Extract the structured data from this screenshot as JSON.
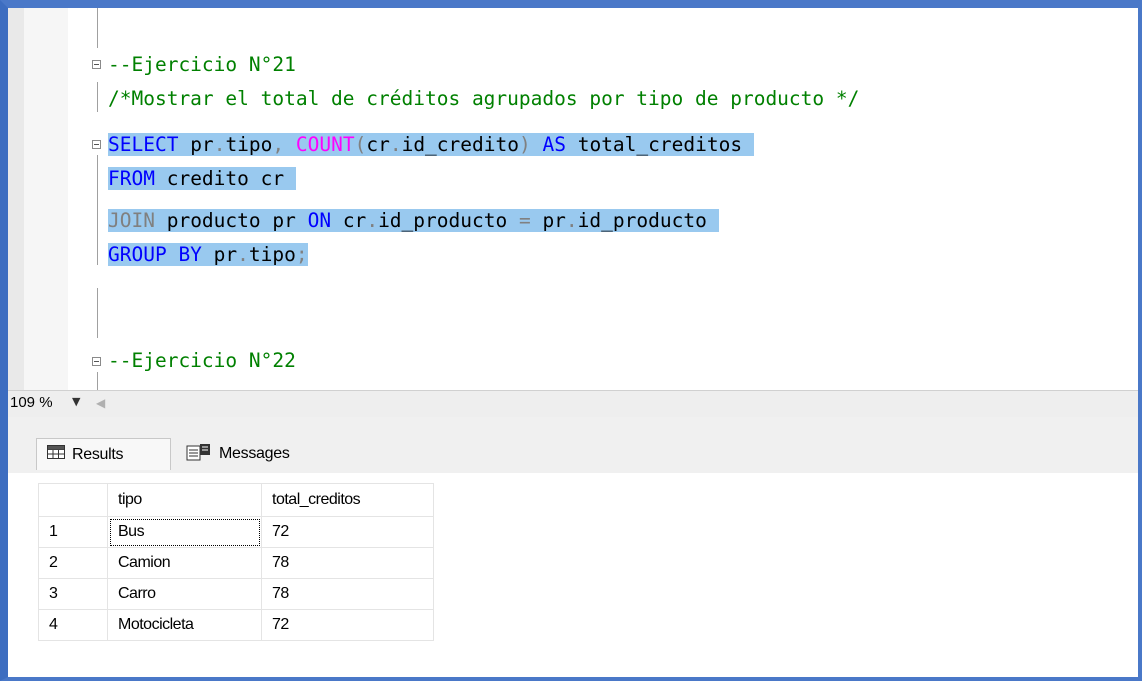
{
  "editor": {
    "lines": [
      "--Ejercicio N°21",
      "/*Mostrar el total de créditos agrupados por tipo de producto */",
      "SELECT pr.tipo, COUNT(cr.id_credito) AS total_creditos",
      "FROM credito cr",
      "JOIN producto pr ON cr.id_producto = pr.id_producto",
      "GROUP BY pr.tipo;",
      "--Ejercicio N°22"
    ],
    "tokens": {
      "select": "SELECT",
      "sel_rest1": " pr",
      "dot": ".",
      "tipo": "tipo",
      "comma": ", ",
      "count": "COUNT",
      "lparen": "(",
      "cr_id": "cr",
      "id_credito": "id_credito",
      "rparen": ")",
      "as": "AS",
      "alias": " total_creditos ",
      "from": "FROM",
      "from_rest": " credito cr ",
      "join": "JOIN",
      "join_mid": " producto pr ",
      "on": "ON",
      "on_left": " cr",
      "id_producto": "id_producto",
      "eq": " = ",
      "pr": "pr",
      "id_producto2": "id_producto ",
      "groupby": "GROUP BY",
      "gb_rest": " pr",
      "gb_tipo": "tipo",
      "semi": ";"
    }
  },
  "zoom": {
    "value": "109 %"
  },
  "tabs": [
    {
      "label": "Results",
      "active": true
    },
    {
      "label": "Messages",
      "active": false
    }
  ],
  "results": {
    "columns": [
      "",
      "tipo",
      "total_creditos"
    ],
    "rows": [
      [
        "1",
        "Bus",
        "72"
      ],
      [
        "2",
        "Camion",
        "78"
      ],
      [
        "3",
        "Carro",
        "78"
      ],
      [
        "4",
        "Motocicleta",
        "72"
      ]
    ]
  }
}
